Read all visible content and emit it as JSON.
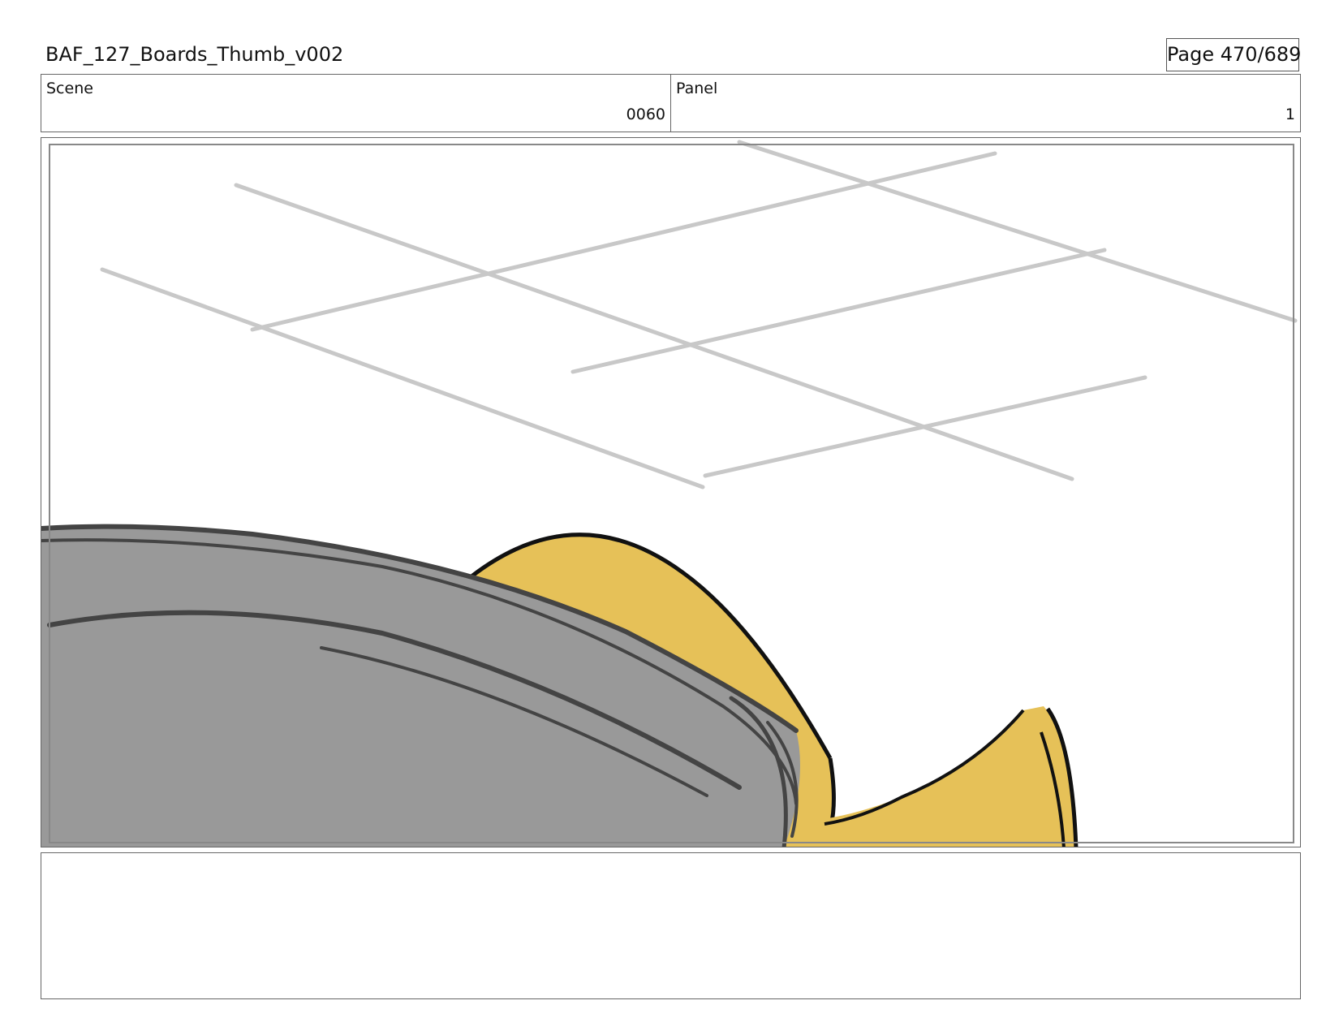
{
  "header": {
    "title": "BAF_127_Boards_Thumb_v002",
    "page": "Page 470/689"
  },
  "info": {
    "scene_label": "Scene",
    "scene_value": "0060",
    "panel_label": "Panel",
    "panel_value": "1"
  },
  "artwork": {
    "colors": {
      "ceiling_lines": "#c8c8c8",
      "gray_shape": "#999999",
      "gray_strokes": "#444444",
      "yellow_shape": "#e6c158",
      "outline": "#111111",
      "inner_frame": "#888888"
    }
  },
  "notes": {
    "text": ""
  }
}
